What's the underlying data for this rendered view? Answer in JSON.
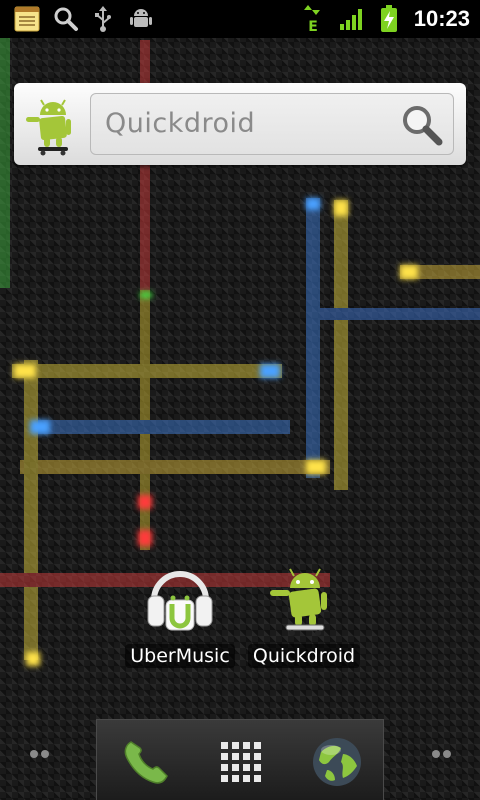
{
  "status_bar": {
    "time": "10:23",
    "left_icons": [
      "notes-icon",
      "search-icon",
      "usb-icon",
      "android-debug-icon"
    ],
    "right_icons": [
      "edge-data-icon",
      "signal-icon",
      "battery-charging-icon"
    ],
    "network_label": "E"
  },
  "search_widget": {
    "placeholder": "Quickdroid",
    "logo": "quickdroid-logo-icon",
    "button_icon": "magnifier-icon"
  },
  "apps": [
    {
      "label": "UberMusic",
      "icon": "headphones-icon"
    },
    {
      "label": "Quickdroid",
      "icon": "android-skateboard-icon"
    }
  ],
  "dock": {
    "items": [
      "phone-icon",
      "app-drawer-icon",
      "browser-globe-icon"
    ]
  },
  "colors": {
    "android_green": "#a4c639",
    "status_green": "#7ed321",
    "status_bar_bg": "#000000"
  }
}
